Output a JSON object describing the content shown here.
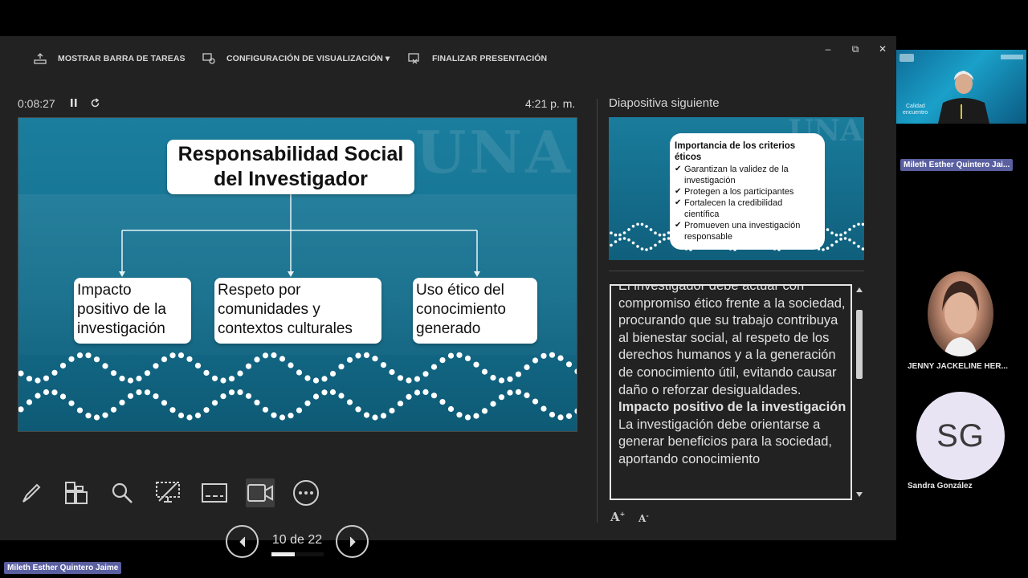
{
  "toolbar": {
    "taskbar_label": "MOSTRAR BARRA DE TAREAS",
    "display_settings_label": "CONFIGURACIÓN DE VISUALIZACIÓN ▾",
    "end_show_label": "FINALIZAR PRESENTACIÓN"
  },
  "window": {
    "minimize": "–",
    "restore": "⧉",
    "close": "✕"
  },
  "timer": {
    "elapsed": "0:08:27",
    "clock": "4:21 p. m."
  },
  "current_slide": {
    "title": "Responsabilidad Social del Investigador",
    "branches": [
      "Impacto positivo de la investigación",
      "Respeto por comunidades y contextos culturales",
      "Uso ético del conocimiento generado"
    ]
  },
  "controls": {
    "tools": [
      "pen-tool-icon",
      "slides-grid-icon",
      "zoom-icon",
      "black-screen-icon",
      "subtitles-icon",
      "camera-icon",
      "more-options-icon"
    ],
    "page_indicator": "10 de 22",
    "progress": 0.45
  },
  "next": {
    "label": "Diapositiva siguiente",
    "heading": "Importancia de los criterios éticos",
    "items": [
      "Garantizan la validez de la investigación",
      "Protegen a los participantes",
      "Fortalecen la credibilidad científica",
      "Promueven una investigación responsable"
    ]
  },
  "notes": {
    "para1": "El investigador debe actuar con compromiso ético frente a la sociedad, procurando que su trabajo contribuya al bienestar social, al respeto de los derechos humanos y a la generación de conocimiento útil, evitando causar daño o reforzar desigualdades.",
    "heading2": "Impacto positivo de la investigación",
    "para2": "La investigación debe orientarse a generar beneficios para la sociedad, aportando conocimiento"
  },
  "participants": {
    "main_tile_name": "Mileth Esther Quintero Jai...",
    "p2_name": "JENNY JACKELINE HER...",
    "p3_initials": "SG",
    "p3_name": "Sandra González",
    "sharing_name": "Mileth Esther Quintero Jaime"
  }
}
